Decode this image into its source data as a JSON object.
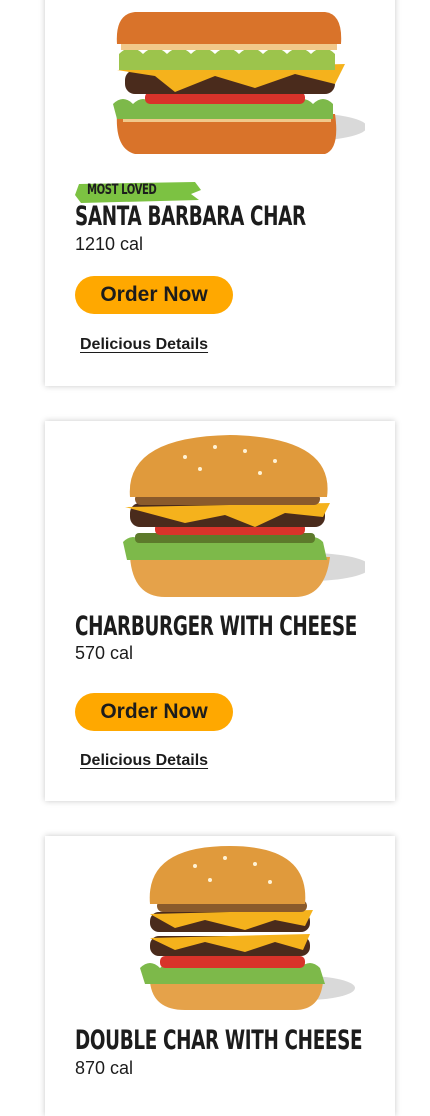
{
  "menu": {
    "items": [
      {
        "badge": "MOST LOVED",
        "name": "SANTA BARBARA CHAR",
        "calories": "1210 cal",
        "order_label": "Order Now",
        "details_label": "Delicious Details",
        "image_icon": "santa-barbara-char-burger-image"
      },
      {
        "badge": "",
        "name": "CHARBURGER WITH CHEESE",
        "calories": "570 cal",
        "order_label": "Order Now",
        "details_label": "Delicious Details",
        "image_icon": "charburger-with-cheese-image"
      },
      {
        "badge": "",
        "name": "DOUBLE CHAR WITH CHEESE",
        "calories": "870 cal",
        "image_icon": "double-char-with-cheese-image"
      }
    ]
  },
  "colors": {
    "button": "#ffa800",
    "badge": "#7cc242",
    "text": "#1c1c1c",
    "card_shadow": "#cccccc"
  }
}
